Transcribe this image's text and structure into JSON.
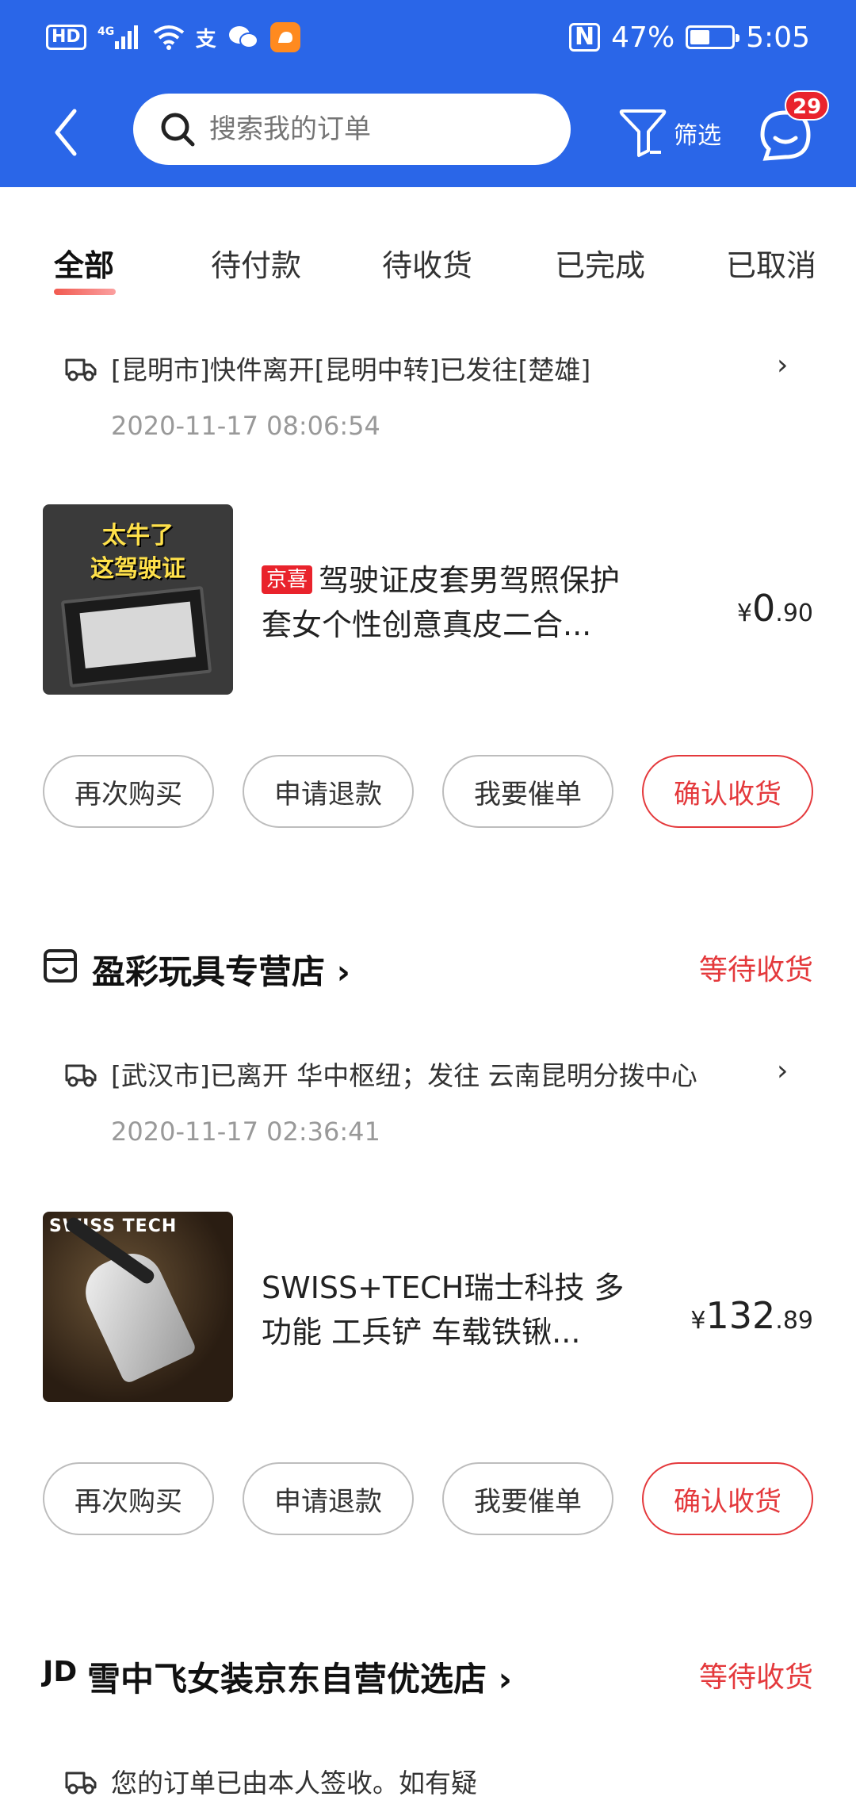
{
  "status_bar": {
    "hd": "HD",
    "net": "4G",
    "alipay": "支",
    "nfc": "N",
    "battery_pct": "47%",
    "battery_fill": 0.47,
    "time": "5:05"
  },
  "header": {
    "search_placeholder": "搜索我的订单",
    "filter_label": "筛选",
    "msg_count": "29",
    "bg_color": "#2a66e8"
  },
  "tabs": [
    "全部",
    "待付款",
    "待收货",
    "已完成",
    "已取消"
  ],
  "orders": [
    {
      "logistics_text": "[昆明市]快件离开[昆明中转]已发往[楚雄]",
      "logistics_time": "2020-11-17 08:06:54",
      "thumb_text_1": "太牛了",
      "thumb_text_2": "这驾驶证",
      "tag": "京喜",
      "name_line_1": "驾驶证皮套男驾照保护",
      "name_line_2": "套女个性创意真皮二合...",
      "price_symbol": "¥",
      "price_int": "0",
      "price_dec": ".90",
      "buttons": [
        "再次购买",
        "申请退款",
        "我要催单",
        "确认收货"
      ]
    },
    {
      "shop_name": "盈彩玩具专营店 ›",
      "status": "等待收货",
      "logistics_text": "[武汉市]已离开 华中枢纽；发往 云南昆明分拨中心",
      "logistics_time": "2020-11-17 02:36:41",
      "thumb_logo": "SWISS TECH",
      "name_line_1": "SWISS+TECH瑞士科技 多",
      "name_line_2": "功能 工兵铲 车载铁锹...",
      "price_symbol": "¥",
      "price_int": "132",
      "price_dec": ".89",
      "buttons": [
        "再次购买",
        "申请退款",
        "我要催单",
        "确认收货"
      ]
    },
    {
      "shop_logo": "JD",
      "shop_name": "雪中飞女装京东自营优选店 ›",
      "status": "等待收货",
      "logistics_text": "您的订单已由本人签收。如有疑"
    }
  ],
  "icons": {
    "back": "back-arrow-icon",
    "search": "search-icon",
    "filter": "filter-icon",
    "message": "message-icon",
    "truck": "truck-icon",
    "shop": "shop-icon",
    "chevron": "chevron-right-icon"
  },
  "colors": {
    "accent_red": "#e4393c",
    "badge_red": "#e9232c"
  }
}
